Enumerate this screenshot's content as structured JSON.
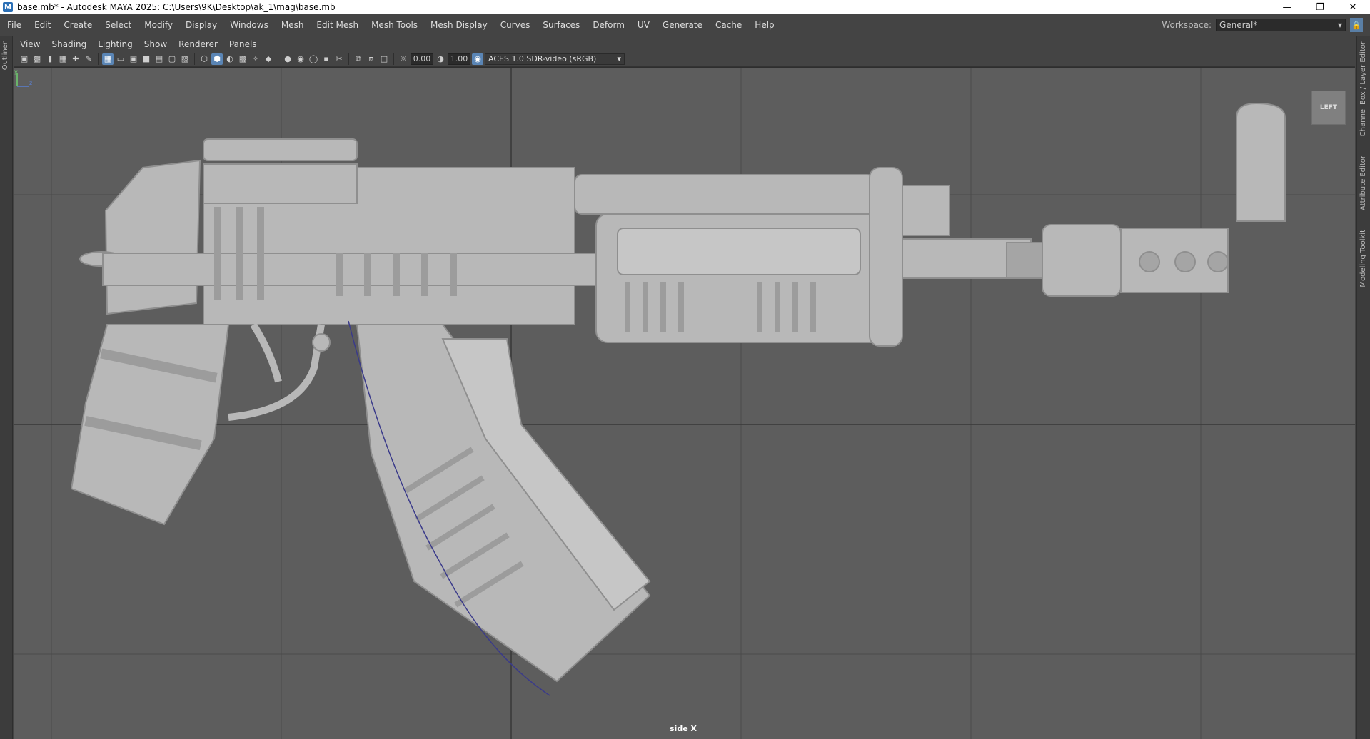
{
  "window": {
    "app_icon": "M",
    "title": "base.mb* - Autodesk MAYA 2025: C:\\Users\\9K\\Desktop\\ak_1\\mag\\base.mb",
    "controls": [
      "minimize-icon",
      "restore-icon",
      "close-icon"
    ]
  },
  "main_menu": [
    "File",
    "Edit",
    "Create",
    "Select",
    "Modify",
    "Display",
    "Windows",
    "Mesh",
    "Edit Mesh",
    "Mesh Tools",
    "Mesh Display",
    "Curves",
    "Surfaces",
    "Deform",
    "UV",
    "Generate",
    "Cache",
    "Help"
  ],
  "workspace": {
    "label": "Workspace:",
    "value": "General*"
  },
  "left_panel": {
    "label": "Outliner"
  },
  "right_tabs": [
    "Channel Box / Layer Editor",
    "Attribute Editor",
    "Modeling Toolkit"
  ],
  "panel_menu": [
    "View",
    "Shading",
    "Lighting",
    "Show",
    "Renderer",
    "Panels"
  ],
  "panel_toolbar": {
    "exposure": "0.00",
    "gamma": "1.00",
    "color_space": "ACES 1.0 SDR-video (sRGB)"
  },
  "viewport": {
    "view_cube_label": "LEFT",
    "camera_label": "side X",
    "axis_labels": {
      "y": "y",
      "z": "z"
    },
    "colors": {
      "background": "#5d5d5d",
      "grid": "#4a4a4a",
      "grid_axis": "#383838",
      "model": "#b8b8b8",
      "model_dark": "#8f8f8f",
      "curve": "#3a3a8a"
    }
  }
}
